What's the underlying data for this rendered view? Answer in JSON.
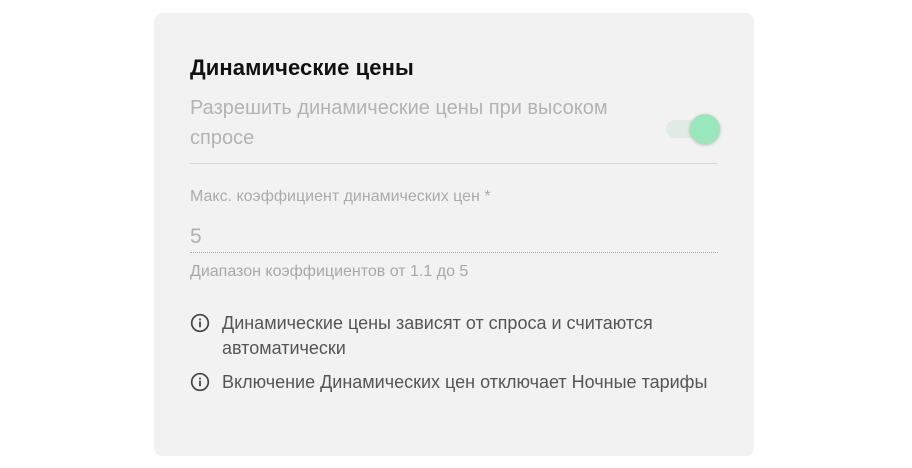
{
  "card": {
    "title": "Динамические цены",
    "toggle": {
      "label": "Разрешить динамические цены при высоком спросе",
      "state": "on",
      "color": "#98e8bc"
    },
    "coefficient_field": {
      "label": "Макс. коэффициент динамических цен *",
      "value": "5",
      "helper": "Диапазон коэффициентов от 1.1 до 5"
    },
    "notes": [
      {
        "icon": "info-icon",
        "text": "Динамические цены зависят от спроса и считаются автоматически"
      },
      {
        "icon": "info-icon",
        "text": "Включение Динамических цен отключает Ночные тарифы"
      }
    ]
  }
}
